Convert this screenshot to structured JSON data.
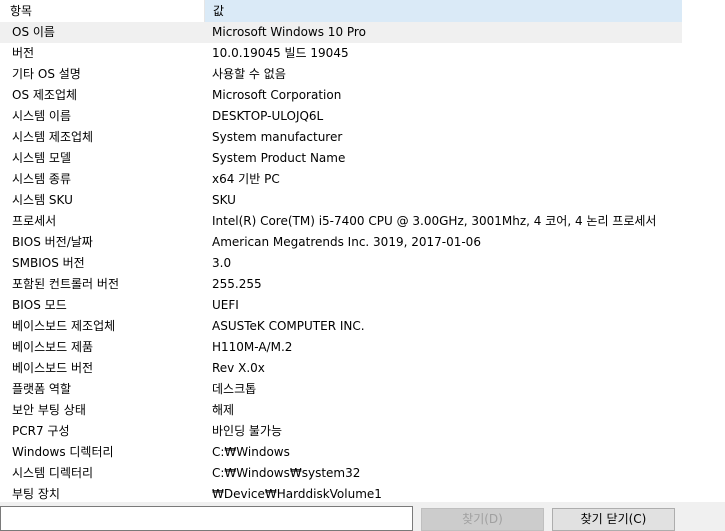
{
  "header": {
    "col_item": "항목",
    "col_value": "값"
  },
  "rows": [
    {
      "k": "OS 이름",
      "v": "Microsoft Windows 10 Pro"
    },
    {
      "k": "버전",
      "v": "10.0.19045 빌드 19045"
    },
    {
      "k": "기타 OS 설명",
      "v": "사용할 수 없음"
    },
    {
      "k": "OS 제조업체",
      "v": "Microsoft Corporation"
    },
    {
      "k": "시스템 이름",
      "v": "DESKTOP-ULOJQ6L"
    },
    {
      "k": "시스템 제조업체",
      "v": "System manufacturer"
    },
    {
      "k": "시스템 모델",
      "v": "System Product Name"
    },
    {
      "k": "시스템 종류",
      "v": "x64 기반 PC"
    },
    {
      "k": "시스템 SKU",
      "v": "SKU"
    },
    {
      "k": "프로세서",
      "v": "Intel(R) Core(TM) i5-7400 CPU @ 3.00GHz, 3001Mhz, 4 코어, 4 논리 프로세서"
    },
    {
      "k": "BIOS 버전/날짜",
      "v": "American Megatrends Inc. 3019, 2017-01-06"
    },
    {
      "k": "SMBIOS 버전",
      "v": "3.0"
    },
    {
      "k": "포함된 컨트롤러 버전",
      "v": "255.255"
    },
    {
      "k": "BIOS 모드",
      "v": "UEFI"
    },
    {
      "k": "베이스보드 제조업체",
      "v": "ASUSTeK COMPUTER INC."
    },
    {
      "k": "베이스보드 제품",
      "v": "H110M-A/M.2"
    },
    {
      "k": "베이스보드 버전",
      "v": "Rev X.0x"
    },
    {
      "k": "플랫폼 역할",
      "v": "데스크톱"
    },
    {
      "k": "보안 부팅 상태",
      "v": "해제"
    },
    {
      "k": "PCR7 구성",
      "v": "바인딩 불가능"
    },
    {
      "k": "Windows 디렉터리",
      "v": "C:₩Windows"
    },
    {
      "k": "시스템 디렉터리",
      "v": "C:₩Windows₩system32"
    },
    {
      "k": "부팅 장치",
      "v": "₩Device₩HarddiskVolume1"
    }
  ],
  "bottom": {
    "search_value": "",
    "find_label": "찾기(D)",
    "close_find_label": "찾기 닫기(C)"
  }
}
